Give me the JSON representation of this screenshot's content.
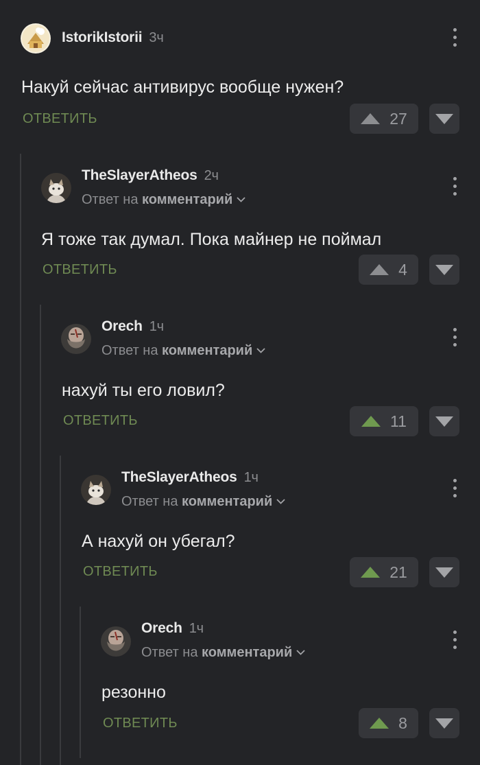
{
  "comments": [
    {
      "author": "IstorikIstorii",
      "time": "3ч",
      "text": "Накуй сейчас антивирус вообще нужен?",
      "reply": "ОТВЕТИТЬ",
      "votes": "27",
      "up_color": "#8c8d90"
    },
    {
      "author": "TheSlayerAtheos",
      "time": "2ч",
      "reply_prefix": "Ответ на",
      "reply_target": "комментарий",
      "text": "Я тоже так думал. Пока майнер не поймал",
      "reply": "ОТВЕТИТЬ",
      "votes": "4",
      "up_color": "#8c8d90"
    },
    {
      "author": "Orech",
      "time": "1ч",
      "reply_prefix": "Ответ на",
      "reply_target": "комментарий",
      "text": "нахуй ты его ловил?",
      "reply": "ОТВЕТИТЬ",
      "votes": "11",
      "up_color": "#6f9a4f"
    },
    {
      "author": "TheSlayerAtheos",
      "time": "1ч",
      "reply_prefix": "Ответ на",
      "reply_target": "комментарий",
      "text": "А нахуй он убегал?",
      "reply": "ОТВЕТИТЬ",
      "votes": "21",
      "up_color": "#6f9a4f"
    },
    {
      "author": "Orech",
      "time": "1ч",
      "reply_prefix": "Ответ на",
      "reply_target": "комментарий",
      "text": "резонно",
      "reply": "ОТВЕТИТЬ",
      "votes": "8",
      "up_color": "#6f9a4f"
    }
  ],
  "icons": {
    "avatar_1": "house-avatar-icon",
    "avatar_2": "cat-avatar-icon",
    "avatar_3": "bearded-man-avatar-icon",
    "vote_up": "triangle-up-icon",
    "vote_down": "triangle-down-icon",
    "more": "more-vertical-icon"
  }
}
